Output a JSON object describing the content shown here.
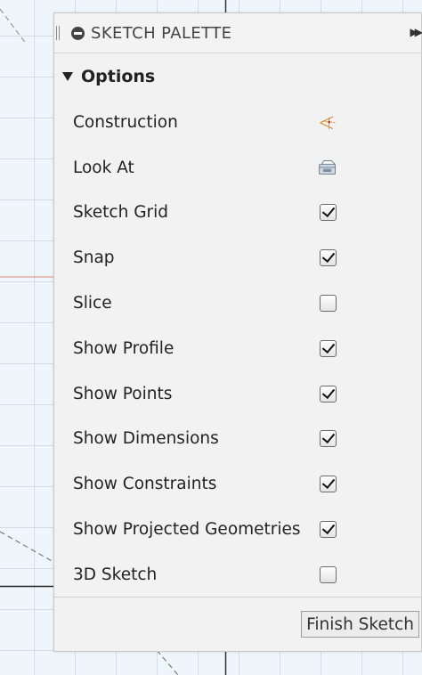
{
  "palette": {
    "title": "SKETCH PALETTE",
    "section_title": "Options",
    "rows": [
      {
        "label": "Construction",
        "control": "construction-icon"
      },
      {
        "label": "Look At",
        "control": "look-at-icon"
      },
      {
        "label": "Sketch Grid",
        "control": "checkbox",
        "checked": true
      },
      {
        "label": "Snap",
        "control": "checkbox",
        "checked": true
      },
      {
        "label": "Slice",
        "control": "checkbox",
        "checked": false
      },
      {
        "label": "Show Profile",
        "control": "checkbox",
        "checked": true
      },
      {
        "label": "Show Points",
        "control": "checkbox",
        "checked": true
      },
      {
        "label": "Show Dimensions",
        "control": "checkbox",
        "checked": true
      },
      {
        "label": "Show Constraints",
        "control": "checkbox",
        "checked": true
      },
      {
        "label": "Show Projected Geometries",
        "control": "checkbox",
        "checked": true
      },
      {
        "label": "3D Sketch",
        "control": "checkbox",
        "checked": false
      }
    ],
    "finish_label": "Finish Sketch"
  },
  "colors": {
    "canvas_bg": "#eef5fb",
    "panel_bg": "#f2f2f2",
    "construction_icon": "#d98a2a",
    "axis_red": "#e2897a"
  }
}
